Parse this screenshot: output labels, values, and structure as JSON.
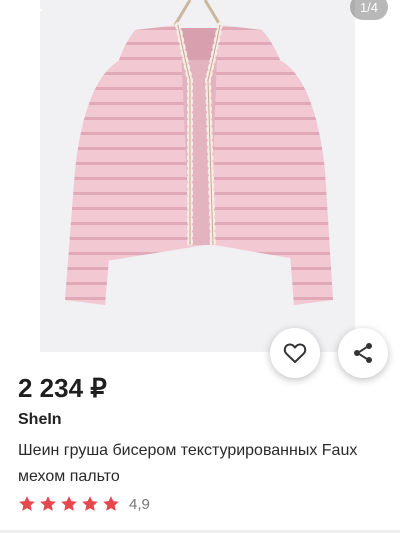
{
  "gallery": {
    "image_alt": "pink faux fur jacket with pearl trim",
    "counter": "1/4",
    "back_icon": "arrow-left-icon",
    "favorite_icon": "heart-outline-icon",
    "share_icon": "share-icon"
  },
  "product": {
    "price": "2 234 ₽",
    "brand": "SheIn",
    "title": "Шеин груша бисером текстурированных Faux мехом пальто",
    "rating": {
      "stars": 5,
      "value": "4,9"
    }
  },
  "colors": {
    "star": "#e5484d",
    "jacket": "#f1c9d3",
    "photo_bg": "#f1f0f2"
  }
}
